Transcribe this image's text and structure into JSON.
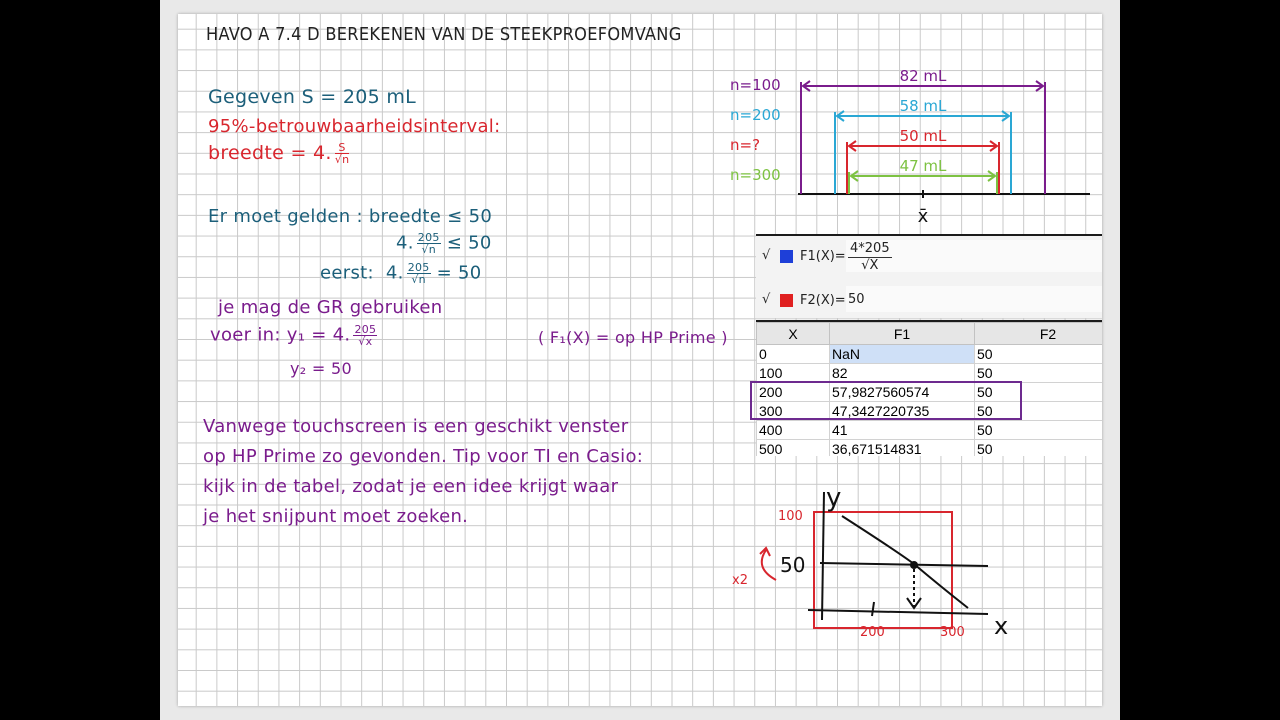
{
  "title": "HAVO A 7.4 D BEREKENEN VAN DE STEEKPROEFOMVANG",
  "given": {
    "line1": "Gegeven  S = 205 mL",
    "line2": "95%-betrouwbaarheidsinterval:",
    "line3_prefix": "breedte = 4.",
    "line3_num": "S",
    "line3_den": "√n"
  },
  "condition": {
    "line1": "Er moet gelden :  breedte ≤ 50",
    "line2_prefix": "4.",
    "line2_num": "205",
    "line2_den": "√n",
    "line2_suffix": "≤ 50",
    "line3_label": "eerst:",
    "line3_prefix": "4.",
    "line3_num": "205",
    "line3_den": "√n",
    "line3_suffix": "= 50"
  },
  "gr": {
    "line1": "je mag de GR gebruiken",
    "line2_prefix": "voer in:  y₁ = 4.",
    "line2_num": "205",
    "line2_den": "√x",
    "line3": "y₂ = 50",
    "note": "( F₁(X) = op HP Prime )"
  },
  "tip": {
    "line1": "Vanwege touchscreen is een geschikt venster",
    "line2": "op HP Prime zo gevonden. Tip voor TI en Casio:",
    "line3": "kijk in de tabel, zodat je een idee krijgt waar",
    "line4": "je het snijpunt moet zoeken."
  },
  "intervals": {
    "labels": [
      "n=100",
      "n=200",
      "n=?",
      "n=300"
    ],
    "widths": [
      "82 mL",
      "58 mL",
      "50 mL",
      "47 mL"
    ],
    "center_label": "x̄",
    "colors": [
      "#7a1c8c",
      "#2aa7d4",
      "#d8262e",
      "#7dc242"
    ]
  },
  "functions": {
    "f1_label": "F1(X)=",
    "f1_num": "4*205",
    "f1_den": "√X",
    "f2_label": "F2(X)=",
    "f2_value": "50",
    "check": "√",
    "f1_color": "#1e3fd8",
    "f2_color": "#e02020"
  },
  "table": {
    "headers": [
      "X",
      "F1",
      "F2"
    ],
    "rows": [
      [
        "0",
        "NaN",
        "50"
      ],
      [
        "100",
        "82",
        "50"
      ],
      [
        "200",
        "57,9827560574",
        "50"
      ],
      [
        "300",
        "47,3427220735",
        "50"
      ],
      [
        "400",
        "41",
        "50"
      ],
      [
        "500",
        "36,671514831",
        "50"
      ]
    ]
  },
  "sketch": {
    "y_label": "y",
    "x_label": "x",
    "y_ticks": [
      "100",
      "50"
    ],
    "x_ticks": [
      "200",
      "300"
    ],
    "zoom_note": "x2"
  }
}
